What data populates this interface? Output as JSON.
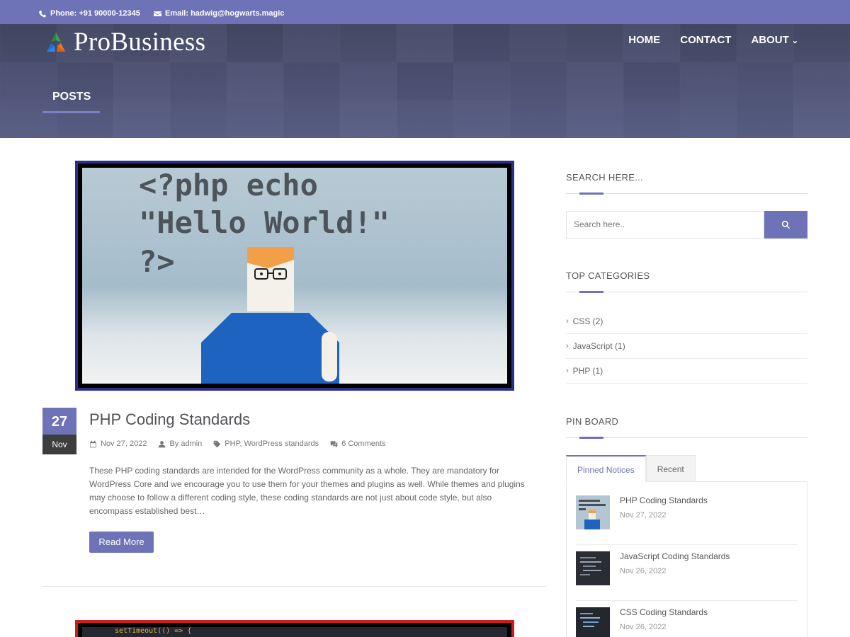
{
  "topbar": {
    "phone": "Phone: +91 90000-12345",
    "email": "Email: hadwig@hogwarts.magic"
  },
  "header": {
    "logo_text": "ProBusiness",
    "nav": [
      "HOME",
      "CONTACT",
      "ABOUT"
    ],
    "page_title": "POSTS"
  },
  "post": {
    "image_code_lines": [
      "<?php echo",
      "\"Hello World!\"",
      "?>"
    ],
    "date_day": "27",
    "date_month": "Nov",
    "title": "PHP Coding Standards",
    "meta_date": "Nov 27, 2022",
    "meta_author": "By admin",
    "meta_tags": "PHP, WordPress standards",
    "meta_comments": "6 Comments",
    "excerpt": "These PHP coding standards are intended for the WordPress community as a whole. They are mandatory for WordPress Core and we encourage you to use them for your themes and plugins as well. While themes and plugins may choose to follow a different coding style, these coding standards are not just about code style, but also encompass established best…",
    "read_more": "Read More"
  },
  "next_post": {
    "code_snippet": "setTimeout(() => {"
  },
  "sidebar": {
    "search_title": "SEARCH HERE...",
    "search_placeholder": "Search here..",
    "categories_title": "TOP CATEGORIES",
    "categories": [
      {
        "label": "CSS (2)"
      },
      {
        "label": "JavaScript (1)"
      },
      {
        "label": "PHP (1)"
      }
    ],
    "pinboard_title": "PIN BOARD",
    "tabs": [
      "Pinned Notices",
      "Recent"
    ],
    "pins": [
      {
        "title": "PHP Coding Standards",
        "date": "Nov 27, 2022"
      },
      {
        "title": "JavaScript Coding Standards",
        "date": "Nov 26, 2022"
      },
      {
        "title": "CSS Coding Standards",
        "date": "Nov 26, 2022"
      }
    ]
  },
  "colors": {
    "accent": "#6d73b6",
    "topbar": "#6d73b6",
    "featured_border": "#2b2f8c",
    "second_border": "#d01c1c"
  }
}
